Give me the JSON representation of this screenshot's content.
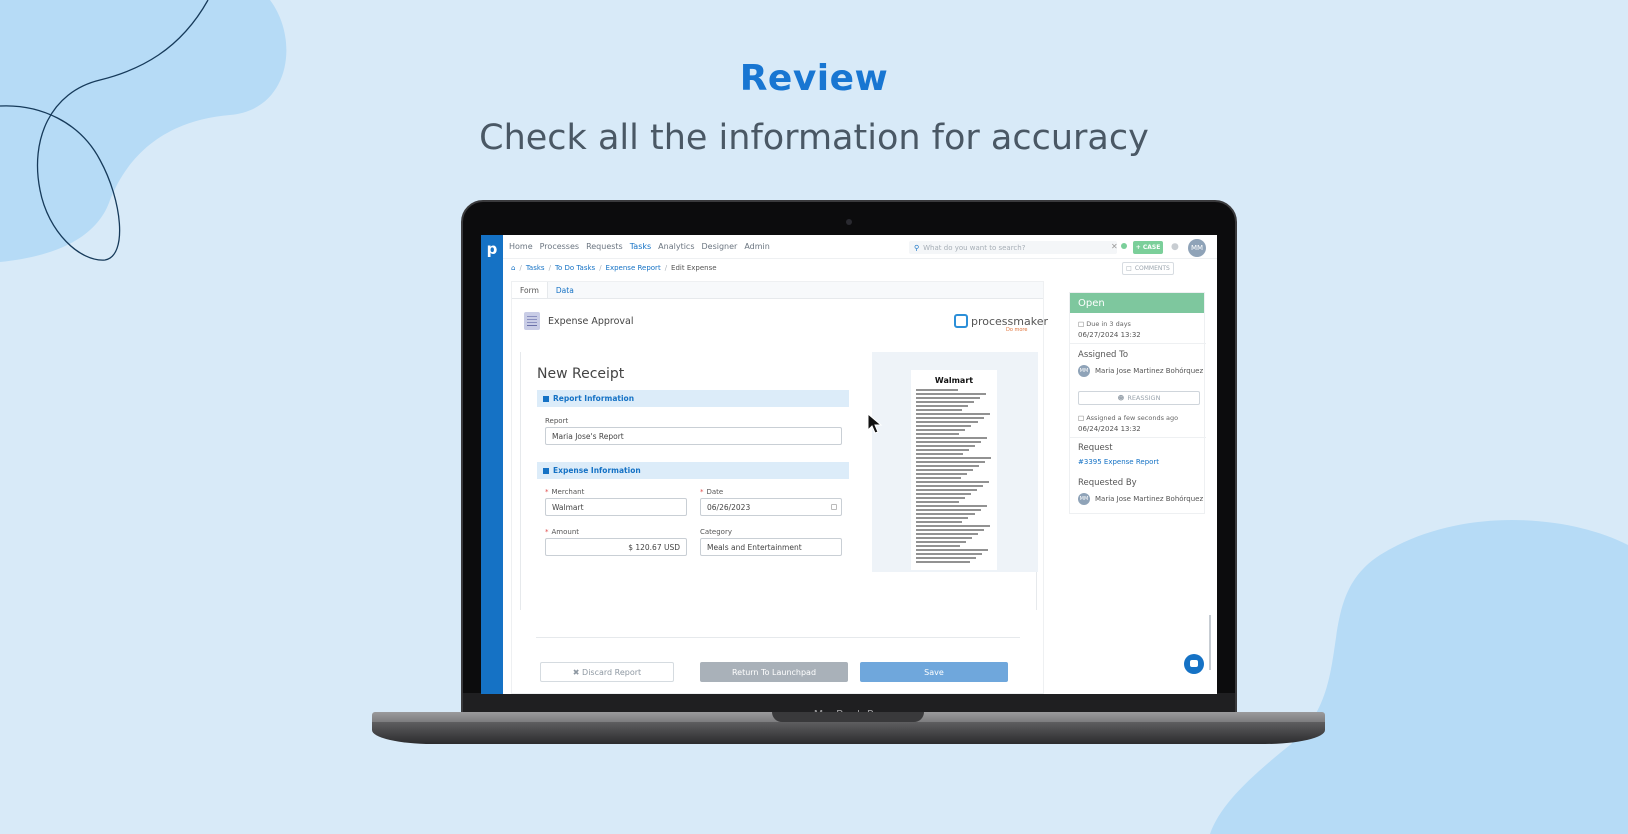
{
  "hero": {
    "title": "Review",
    "subtitle": "Check all the information for accuracy"
  },
  "device": {
    "label": "MacBook Pro"
  },
  "app": {
    "nav": [
      "Home",
      "Processes",
      "Requests",
      "Tasks",
      "Analytics",
      "Designer",
      "Admin"
    ],
    "active_nav": "Tasks",
    "search_placeholder": "What do you want to search?",
    "case_button": "+ CASE",
    "user_initials": "MM",
    "breadcrumb": [
      "Tasks",
      "To Do Tasks",
      "Expense Report",
      "Edit Expense"
    ],
    "comments_button": "COMMENTS"
  },
  "form": {
    "tabs": [
      "Form",
      "Data"
    ],
    "header_title": "Expense Approval",
    "logo_word": "processmaker",
    "logo_tagline": "Do more",
    "heading": "New Receipt",
    "section_report": "Report Information",
    "report_label": "Report",
    "report_value": "Maria Jose's Report",
    "section_expense": "Expense Information",
    "merchant_label": "Merchant",
    "merchant_value": "Walmart",
    "date_label": "Date",
    "date_value": "06/26/2023",
    "amount_label": "Amount",
    "amount_value": "$ 120.67 USD",
    "category_label": "Category",
    "category_value": "Meals and Entertainment",
    "receipt_store": "Walmart"
  },
  "buttons": {
    "discard": "✖ Discard Report",
    "return": "Return To Launchpad",
    "save": "Save"
  },
  "task_panel": {
    "status": "Open",
    "due_label": "Due in 3 days",
    "due_date": "06/27/2024 13:32",
    "assigned_to_heading": "Assigned To",
    "assignee": "Maria Jose Martinez Bohórquez",
    "reassign_button": "REASSIGN",
    "assigned_ago": "Assigned a few seconds ago",
    "assigned_date": "06/24/2024 13:32",
    "request_heading": "Request",
    "request_link": "#3395 Expense Report",
    "requested_by_heading": "Requested By",
    "requester": "Maria Jose Martinez Bohórquez"
  }
}
